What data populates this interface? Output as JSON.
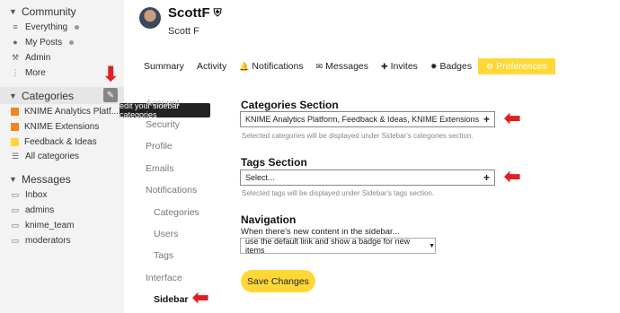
{
  "sidebar": {
    "community": {
      "title": "Community",
      "items": [
        {
          "label": "Everything",
          "icon": "stack-icon"
        },
        {
          "label": "My Posts",
          "icon": "user-icon"
        },
        {
          "label": "Admin",
          "icon": "wrench-icon"
        },
        {
          "label": "More",
          "icon": "vertical-dots-icon"
        }
      ]
    },
    "categories": {
      "title": "Categories",
      "edit_tooltip": "edit your sidebar categories",
      "items": [
        {
          "label": "KNIME Analytics Platf...",
          "color": "#f5841f"
        },
        {
          "label": "KNIME Extensions",
          "color": "#f5841f"
        },
        {
          "label": "Feedback & Ideas",
          "color": "#ffd838"
        },
        {
          "label": "All categories",
          "icon": "list-icon"
        }
      ]
    },
    "messages": {
      "title": "Messages",
      "items": [
        {
          "label": "Inbox"
        },
        {
          "label": "admins"
        },
        {
          "label": "knime_team"
        },
        {
          "label": "moderators"
        }
      ]
    }
  },
  "user": {
    "username": "ScottF",
    "full_name": "Scott F"
  },
  "tabs": [
    {
      "label": "Summary"
    },
    {
      "label": "Activity"
    },
    {
      "label": "Notifications"
    },
    {
      "label": "Messages"
    },
    {
      "label": "Invites"
    },
    {
      "label": "Badges"
    },
    {
      "label": "Preferences"
    }
  ],
  "pref_nav": {
    "account": "Account",
    "security": "Security",
    "profile": "Profile",
    "emails": "Emails",
    "notifications": "Notifications",
    "categories": "Categories",
    "users": "Users",
    "tags": "Tags",
    "interface": "Interface",
    "sidebar": "Sidebar"
  },
  "content": {
    "categories_section": {
      "title": "Categories Section",
      "value": "KNIME Analytics Platform, Feedback & Ideas, KNIME Extensions",
      "hint": "Selected categories will be displayed under Sidebar's categories section."
    },
    "tags_section": {
      "title": "Tags Section",
      "placeholder": "Select...",
      "hint": "Selected tags will be displayed under Sidebar's tags section."
    },
    "navigation": {
      "title": "Navigation",
      "description": "When there's new content in the sidebar...",
      "selected": "use the default link and show a badge for new items"
    },
    "save_label": "Save Changes"
  },
  "colors": {
    "accent": "#ffd838",
    "annotation_arrow": "#e02020",
    "category_orange": "#f5841f"
  }
}
